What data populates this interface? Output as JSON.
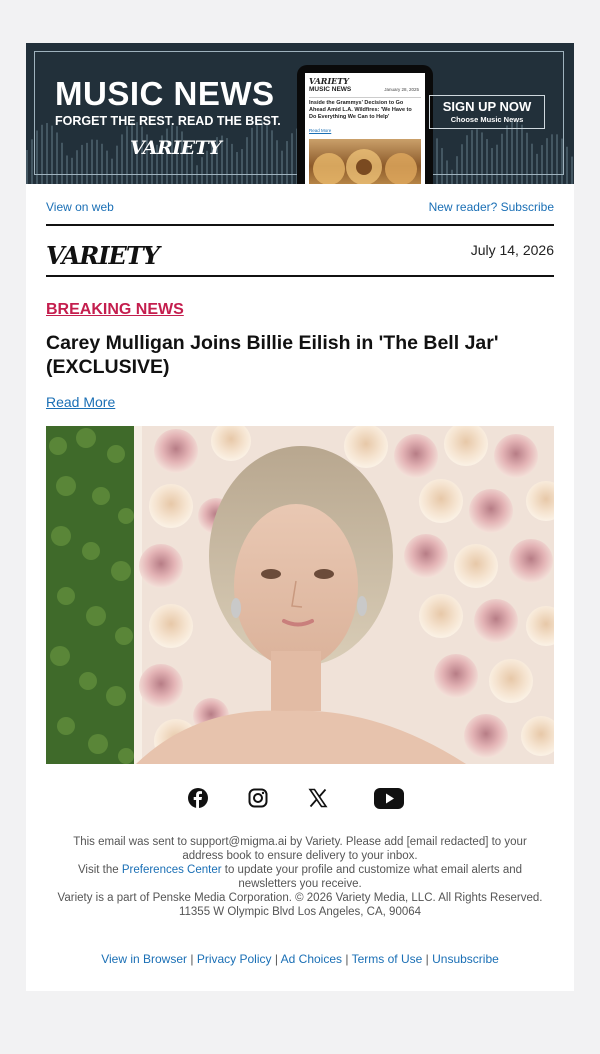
{
  "banner": {
    "title": "MUSIC NEWS",
    "subtitle": "FORGET THE REST. READ THE BEST.",
    "logo": "VARIETY",
    "phone": {
      "logo": "VARIETY",
      "section": "MUSIC NEWS",
      "date": "January 28, 2025",
      "headline": "Inside the Grammys' Decision to Go Ahead Amid L.A. Wildfires: 'We Have to Do Everything We Can to Help'",
      "read_more": "Read More"
    },
    "signup_main": "SIGN UP NOW",
    "signup_sub": "Choose Music News"
  },
  "toplinks": {
    "view_on_web": "View on web",
    "subscribe": "New reader? Subscribe"
  },
  "header": {
    "logo": "VARIETY",
    "date": "July 14, 2026"
  },
  "article": {
    "kicker": "BREAKING NEWS",
    "headline": "Carey Mulligan Joins Billie Eilish in 'The Bell Jar' (EXCLUSIVE)",
    "read_more": "Read More",
    "photo_icon": "portrait-photo"
  },
  "social": {
    "icons": [
      "facebook-icon",
      "instagram-icon",
      "x-icon",
      "youtube-icon"
    ]
  },
  "footer": {
    "line1": "This email was sent to support@migma.ai by Variety. Please add [email redacted] to your address book to ensure delivery to your inbox.",
    "line2_pre": "Visit the ",
    "line2_link": "Preferences Center",
    "line2_post": " to update your profile and customize what email alerts and newsletters you receive.",
    "line3": "Variety is a part of Penske Media Corporation. © 2026 Variety Media, LLC. All Rights Reserved.",
    "line4": "11355 W Olympic Blvd Los Angeles, CA, 90064",
    "links": [
      "View in Browser",
      "Privacy Policy",
      "Ad Choices",
      "Terms of Use",
      "Unsubscribe"
    ],
    "separator": "|"
  },
  "colors": {
    "banner_bg": "#22303a",
    "link": "#1a6fb5",
    "breaking": "#c41e4e"
  }
}
